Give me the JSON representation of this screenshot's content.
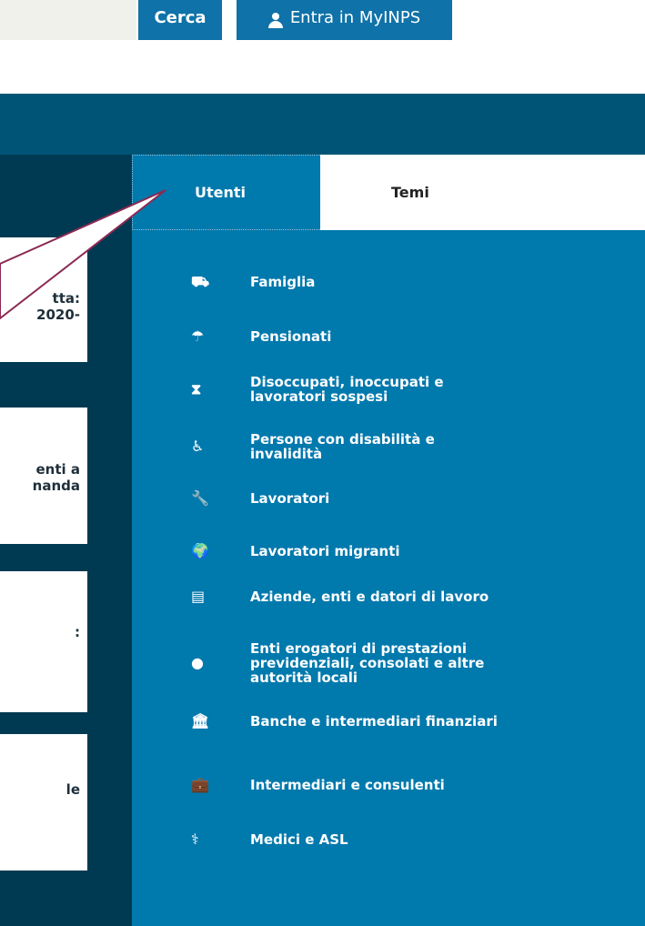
{
  "header": {
    "search_button": "Cerca",
    "login_button": "Entra in MyINPS"
  },
  "cards": [
    {
      "lines": [
        "tta:",
        "2020-"
      ]
    },
    {
      "lines": [
        "enti a",
        "nanda"
      ]
    },
    {
      "lines": [
        ":"
      ]
    },
    {
      "lines": [
        "le"
      ]
    }
  ],
  "tabs": {
    "users": "Utenti",
    "topics": "Temi"
  },
  "menu": [
    {
      "icon": "stroller-icon",
      "glyph": "⛟",
      "label": "Famiglia"
    },
    {
      "icon": "umbrella-icon",
      "glyph": "☂",
      "label": "Pensionati"
    },
    {
      "icon": "hourglass-icon",
      "glyph": "⧗",
      "label": "Disoccupati, inoccupati e lavoratori sospesi"
    },
    {
      "icon": "wheelchair-icon",
      "glyph": "♿",
      "label": "Persone con disabilità e invalidità"
    },
    {
      "icon": "wrench-icon",
      "glyph": "🔧",
      "label": "Lavoratori"
    },
    {
      "icon": "globe-icon",
      "glyph": "🌍",
      "label": "Lavoratori migranti"
    },
    {
      "icon": "building-icon",
      "glyph": "▤",
      "label": "Aziende, enti e datori di lavoro"
    },
    {
      "icon": "piggy-bank-icon",
      "glyph": "●",
      "label": "Enti erogatori di prestazioni previdenziali, consolati e altre autorità locali"
    },
    {
      "icon": "bank-icon",
      "glyph": "🏛",
      "label": "Banche e intermediari finanziari"
    },
    {
      "icon": "briefcase-icon",
      "glyph": "💼",
      "label": "Intermediari e consulenti"
    },
    {
      "icon": "stethoscope-icon",
      "glyph": "⚕",
      "label": "Medici e ASL"
    }
  ]
}
